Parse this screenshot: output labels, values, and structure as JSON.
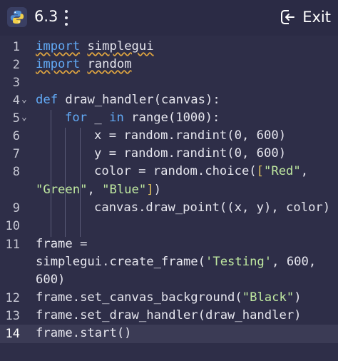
{
  "header": {
    "title": "6.3",
    "exit_label": "Exit",
    "logo_icon": "python-logo-icon",
    "menu_icon": "kebab-menu-icon",
    "exit_icon": "exit-icon"
  },
  "editor": {
    "line_numbers": [
      "1",
      "2",
      "3",
      "4",
      "5",
      "6",
      "7",
      "8",
      "9",
      "10",
      "11",
      "12",
      "13",
      "14"
    ],
    "current_line": "14",
    "code": {
      "l1_kw": "import",
      "l1_mod": "simplegui",
      "l2_kw": "import",
      "l2_mod": "random",
      "l4_kw": "def",
      "l4_rest": " draw_handler(canvas):",
      "l5_kw": "for",
      "l5_a": " _ ",
      "l5_in": "in",
      "l5_b": " range(1000):",
      "l6": "x = random.randint(0, 600)",
      "l7": "y = random.randint(0, 600)",
      "l8_a": "color = random.choice(",
      "l8_br": "[",
      "l8_s1": "\"Red\"",
      "l8_c1": ",",
      "l8b_s2": "\"Green\"",
      "l8b_c2": ", ",
      "l8b_s3": "\"Blue\"",
      "l8b_br": "]",
      "l8b_end": ")",
      "l9": "canvas.draw_point((x, y), color)",
      "l11a": "frame =",
      "l11b_a": "simplegui.create_frame(",
      "l11b_s": "'Testing'",
      "l11b_b": ", 600,",
      "l11c": "600)",
      "l12_a": "frame.set_canvas_background(",
      "l12_s": "\"Black\"",
      "l12_b": ")",
      "l13": "frame.set_draw_handler(draw_handler)",
      "l14": "frame.start()"
    },
    "fold_marker": "⌄"
  },
  "colors": {
    "background": "#2e2e48",
    "keyword": "#62aaf6",
    "string": "#bfe8a0",
    "warning_underline": "#e1a640",
    "current_line": "#3b3b55"
  }
}
